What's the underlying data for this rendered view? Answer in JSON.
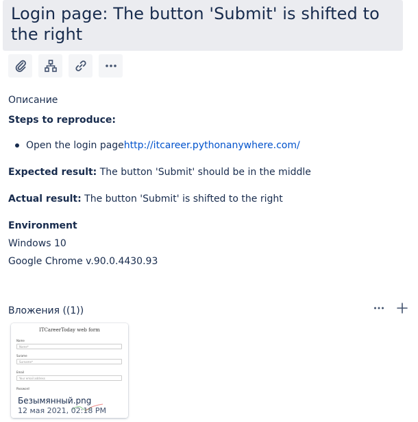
{
  "issue": {
    "title": "Login page: The button 'Submit' is shifted to the right"
  },
  "toolbar": {
    "icons": [
      "attachment-icon",
      "child-issues-icon",
      "link-icon",
      "more-icon"
    ]
  },
  "description": {
    "label": "Описание",
    "steps_heading": "Steps to reproduce:",
    "step_1_text": "Open the login page ",
    "step_1_link": "http://itcareer.pythonanywhere.com/",
    "expected_label": "Expected result:",
    "expected_text": " The button 'Submit' should be in the middle",
    "actual_label": "Actual result:",
    "actual_text": " The button 'Submit' is shifted to the right",
    "environment_heading": "Environment",
    "env_os": "Windows 10",
    "env_browser": "Google Chrome v.90.0.4430.93"
  },
  "attachments": {
    "header": "Вложения ((1))",
    "items": [
      {
        "filename": "Безымянный.png",
        "date": "12 мая 2021, 02:18 PM",
        "thumbnail": {
          "title": "ITCareerToday web form",
          "fields": [
            {
              "label": "Name",
              "placeholder": "Name*"
            },
            {
              "label": "Surame",
              "placeholder": "Surname*"
            },
            {
              "label": "Email",
              "placeholder": "Your email address"
            },
            {
              "label": "Password",
              "placeholder": ""
            }
          ]
        }
      }
    ]
  },
  "colors": {
    "text": "#172b4d",
    "link": "#0052cc",
    "title_bg": "#ebecf0",
    "button_bg": "#f4f5f7"
  }
}
